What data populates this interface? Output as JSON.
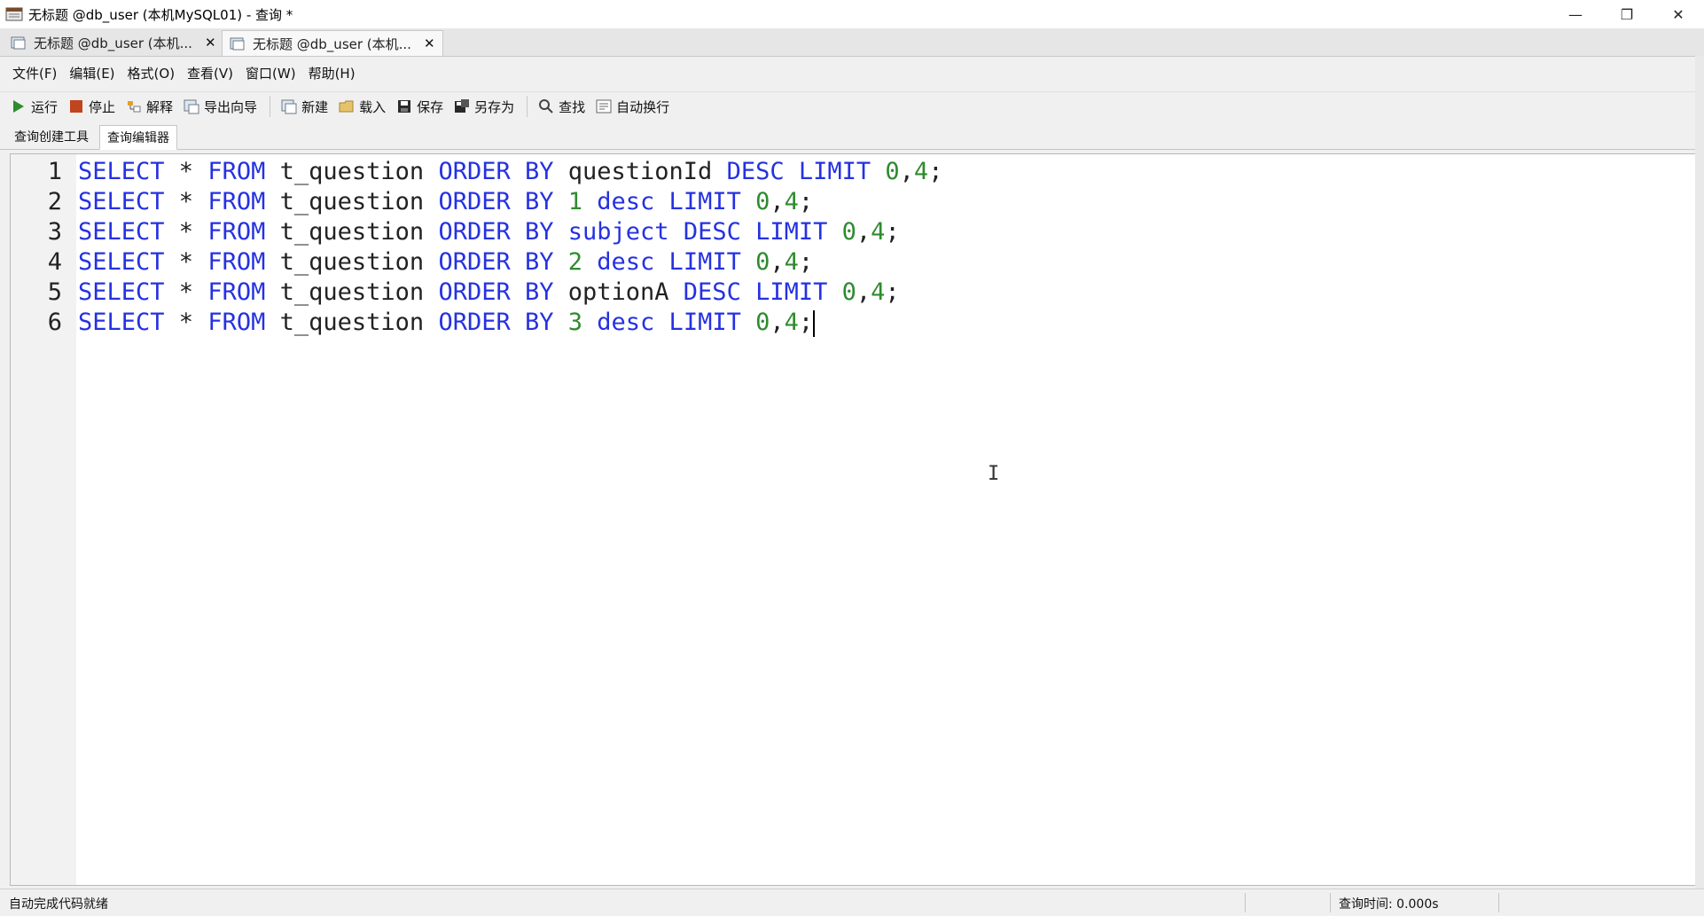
{
  "window": {
    "title": "无标题 @db_user (本机MySQL01) - 查询 *",
    "minimize_glyph": "—",
    "restore_glyph": "❐",
    "close_glyph": "✕"
  },
  "doc_tabs": [
    {
      "label": "无标题 @db_user (本机...",
      "close": "✕"
    },
    {
      "label": "无标题 @db_user (本机...",
      "close": "✕"
    }
  ],
  "menu": [
    "文件(F)",
    "编辑(E)",
    "格式(O)",
    "查看(V)",
    "窗口(W)",
    "帮助(H)"
  ],
  "toolbar": {
    "run": "运行",
    "stop": "停止",
    "explain": "解释",
    "export_wizard": "导出向导",
    "new": "新建",
    "load": "载入",
    "save": "保存",
    "save_as": "另存为",
    "find": "查找",
    "word_wrap": "自动换行"
  },
  "query_tabs": [
    "查询创建工具",
    "查询编辑器"
  ],
  "editor": {
    "lines": [
      {
        "n": "1",
        "tokens": [
          [
            "kw",
            "SELECT"
          ],
          [
            "plain",
            " * "
          ],
          [
            "kw",
            "FROM"
          ],
          [
            "plain",
            " t_question "
          ],
          [
            "kw",
            "ORDER BY"
          ],
          [
            "plain",
            " questionId "
          ],
          [
            "kw",
            "DESC LIMIT"
          ],
          [
            "plain",
            " "
          ],
          [
            "num",
            "0"
          ],
          [
            "plain",
            ","
          ],
          [
            "num",
            "4"
          ],
          [
            "plain",
            ";"
          ]
        ]
      },
      {
        "n": "2",
        "tokens": [
          [
            "kw",
            "SELECT"
          ],
          [
            "plain",
            " * "
          ],
          [
            "kw",
            "FROM"
          ],
          [
            "plain",
            " t_question "
          ],
          [
            "kw",
            "ORDER BY"
          ],
          [
            "plain",
            " "
          ],
          [
            "num",
            "1"
          ],
          [
            "plain",
            " "
          ],
          [
            "kw",
            "desc LIMIT"
          ],
          [
            "plain",
            " "
          ],
          [
            "num",
            "0"
          ],
          [
            "plain",
            ","
          ],
          [
            "num",
            "4"
          ],
          [
            "plain",
            ";"
          ]
        ]
      },
      {
        "n": "3",
        "tokens": [
          [
            "kw",
            "SELECT"
          ],
          [
            "plain",
            " * "
          ],
          [
            "kw",
            "FROM"
          ],
          [
            "plain",
            " t_question "
          ],
          [
            "kw",
            "ORDER BY"
          ],
          [
            "plain",
            " "
          ],
          [
            "kw",
            "subject"
          ],
          [
            "plain",
            " "
          ],
          [
            "kw",
            "DESC LIMIT"
          ],
          [
            "plain",
            " "
          ],
          [
            "num",
            "0"
          ],
          [
            "plain",
            ","
          ],
          [
            "num",
            "4"
          ],
          [
            "plain",
            ";"
          ]
        ]
      },
      {
        "n": "4",
        "tokens": [
          [
            "kw",
            "SELECT"
          ],
          [
            "plain",
            " * "
          ],
          [
            "kw",
            "FROM"
          ],
          [
            "plain",
            " t_question "
          ],
          [
            "kw",
            "ORDER BY"
          ],
          [
            "plain",
            " "
          ],
          [
            "num",
            "2"
          ],
          [
            "plain",
            " "
          ],
          [
            "kw",
            "desc LIMIT"
          ],
          [
            "plain",
            " "
          ],
          [
            "num",
            "0"
          ],
          [
            "plain",
            ","
          ],
          [
            "num",
            "4"
          ],
          [
            "plain",
            ";"
          ]
        ]
      },
      {
        "n": "5",
        "tokens": [
          [
            "kw",
            "SELECT"
          ],
          [
            "plain",
            " * "
          ],
          [
            "kw",
            "FROM"
          ],
          [
            "plain",
            " t_question "
          ],
          [
            "kw",
            "ORDER BY"
          ],
          [
            "plain",
            " optionA "
          ],
          [
            "kw",
            "DESC LIMIT"
          ],
          [
            "plain",
            " "
          ],
          [
            "num",
            "0"
          ],
          [
            "plain",
            ","
          ],
          [
            "num",
            "4"
          ],
          [
            "plain",
            ";"
          ]
        ]
      },
      {
        "n": "6",
        "tokens": [
          [
            "kw",
            "SELECT"
          ],
          [
            "plain",
            " * "
          ],
          [
            "kw",
            "FROM"
          ],
          [
            "plain",
            " t_question "
          ],
          [
            "kw",
            "ORDER BY"
          ],
          [
            "plain",
            " "
          ],
          [
            "num",
            "3"
          ],
          [
            "plain",
            " "
          ],
          [
            "kw",
            "desc LIMIT"
          ],
          [
            "plain",
            " "
          ],
          [
            "num",
            "0"
          ],
          [
            "plain",
            ","
          ],
          [
            "num",
            "4"
          ],
          [
            "plain",
            ";"
          ]
        ]
      }
    ],
    "colors": {
      "keyword": "#2531e0",
      "number": "#2e8b2e",
      "plain": "#222222"
    }
  },
  "status": {
    "left": "自动完成代码就绪",
    "query_time": "查询时间: 0.000s"
  }
}
